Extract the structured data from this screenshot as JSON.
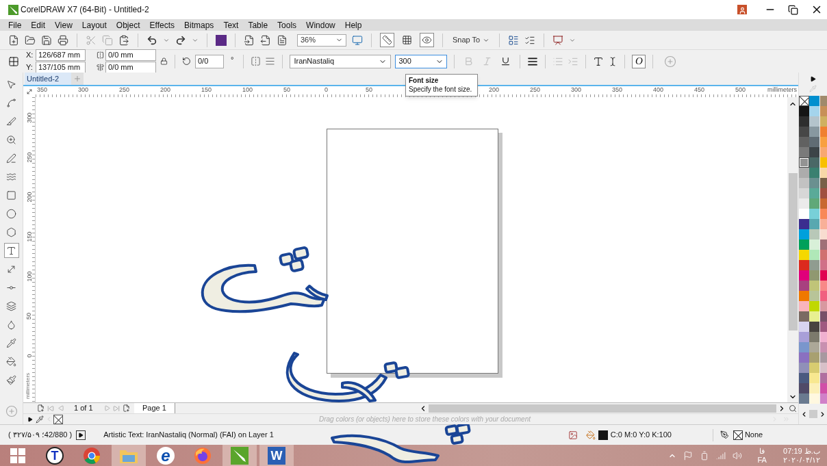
{
  "window": {
    "title": "CorelDRAW X7 (64-Bit) - Untitled-2"
  },
  "menu": [
    "File",
    "Edit",
    "View",
    "Layout",
    "Object",
    "Effects",
    "Bitmaps",
    "Text",
    "Table",
    "Tools",
    "Window",
    "Help"
  ],
  "toolbar": {
    "zoom": "36%",
    "snap": "Snap To",
    "toggles": [
      {
        "kind": "rulers",
        "on": true
      },
      {
        "kind": "grid",
        "on": false
      },
      {
        "kind": "guides",
        "on": true
      }
    ]
  },
  "property_bar": {
    "x_label": "X:",
    "x": "126/687 mm",
    "y_label": "Y:",
    "y": "137/105 mm",
    "width": "0/0 mm",
    "height": "0/0 mm",
    "rotation": "0/0",
    "degree": "°",
    "font": "IranNastaliq",
    "font_size": "300",
    "opentype": "O",
    "text_style": [
      {
        "kind": "bold",
        "disabled": true
      },
      {
        "kind": "italic",
        "disabled": true
      },
      {
        "kind": "underline",
        "disabled": false
      }
    ]
  },
  "tooltip": {
    "title": "Font size",
    "text": "Specify the font size."
  },
  "document_tabs": [
    {
      "label": "Untitled-2",
      "selected": true
    }
  ],
  "ruler": {
    "left_labels": [
      "350",
      "300",
      "250",
      "200",
      "150",
      "100",
      "50",
      "0",
      "50"
    ],
    "right_labels": [
      "200",
      "250",
      "300",
      "350",
      "400",
      "450",
      "500"
    ],
    "unit": "millimeters",
    "vertical_labels": [
      "300",
      "250",
      "200",
      "150",
      "100",
      "50",
      "0"
    ],
    "vertical_unit": "millimeters"
  },
  "tools": [
    {
      "kind": "pick",
      "selected": false
    },
    {
      "kind": "shape",
      "selected": false
    },
    {
      "kind": "crop",
      "selected": false
    },
    {
      "kind": "zoom",
      "selected": false
    },
    {
      "kind": "freehand",
      "selected": false
    },
    {
      "kind": "artistic",
      "selected": false
    },
    {
      "kind": "rectangle",
      "selected": false
    },
    {
      "kind": "ellipse",
      "selected": false
    },
    {
      "kind": "polygon",
      "selected": false
    },
    {
      "kind": "text",
      "selected": true
    },
    {
      "kind": "dimension",
      "selected": false
    },
    {
      "kind": "connector",
      "selected": false
    },
    {
      "kind": "shadow",
      "selected": false
    },
    {
      "kind": "transparency",
      "selected": false
    },
    {
      "kind": "eyedropper",
      "selected": false
    },
    {
      "kind": "fill",
      "selected": false
    },
    {
      "kind": "smart_fill",
      "selected": false
    }
  ],
  "page_nav": {
    "counter": "1 of 1",
    "pages": [
      {
        "label": "Page 1",
        "selected": true
      }
    ]
  },
  "document_palette": {
    "hint": "Drag colors (or objects) here to store these colors with your document"
  },
  "palette": {
    "columns": [
      [
        {
          "kind": "none",
          "selected": false
        },
        {
          "kind": "color",
          "color": "#151515",
          "selected": false
        },
        {
          "kind": "color",
          "color": "#2e2e2e",
          "selected": false
        },
        {
          "kind": "color",
          "color": "#474747",
          "selected": false
        },
        {
          "kind": "color",
          "color": "#616161",
          "selected": false
        },
        {
          "kind": "color",
          "color": "#7a7a7a",
          "selected": false
        },
        {
          "kind": "color",
          "color": "#939393",
          "selected": true
        },
        {
          "kind": "color",
          "color": "#acacac",
          "selected": false
        },
        {
          "kind": "color",
          "color": "#c2c2c2",
          "selected": false
        },
        {
          "kind": "color",
          "color": "#d7d7d7",
          "selected": false
        },
        {
          "kind": "color",
          "color": "#ebebeb",
          "selected": false
        },
        {
          "kind": "color",
          "color": "#ffffff",
          "selected": false
        },
        {
          "kind": "color",
          "color": "#3b2e8f",
          "selected": false
        },
        {
          "kind": "color",
          "color": "#00a0dc",
          "selected": false
        },
        {
          "kind": "color",
          "color": "#00a05a",
          "selected": false
        },
        {
          "kind": "color",
          "color": "#f5d800",
          "selected": false
        },
        {
          "kind": "color",
          "color": "#dc2a1e",
          "selected": false
        },
        {
          "kind": "color",
          "color": "#e0007a",
          "selected": false
        },
        {
          "kind": "color",
          "color": "#a8417f",
          "selected": false
        },
        {
          "kind": "color",
          "color": "#f07800",
          "selected": false
        },
        {
          "kind": "color",
          "color": "#f9b4bb",
          "selected": false
        },
        {
          "kind": "color",
          "color": "#7a6a62",
          "selected": false
        },
        {
          "kind": "color",
          "color": "#d8d4f0",
          "selected": false
        },
        {
          "kind": "color",
          "color": "#a89fd8",
          "selected": false
        },
        {
          "kind": "color",
          "color": "#7a96cc",
          "selected": false
        },
        {
          "kind": "color",
          "color": "#8a70c0",
          "selected": false
        },
        {
          "kind": "color",
          "color": "#9090b8",
          "selected": false
        },
        {
          "kind": "color",
          "color": "#4a5a80",
          "selected": false
        },
        {
          "kind": "color",
          "color": "#504a68",
          "selected": false
        },
        {
          "kind": "color",
          "color": "#6a7a90",
          "selected": false
        }
      ],
      [
        {
          "kind": "color",
          "color": "#008fcf",
          "selected": false
        },
        {
          "kind": "color",
          "color": "#a4d4ec",
          "selected": false
        },
        {
          "kind": "color",
          "color": "#b4c4cc",
          "selected": false
        },
        {
          "kind": "color",
          "color": "#8898a0",
          "selected": false
        },
        {
          "kind": "color",
          "color": "#606c74",
          "selected": false
        },
        {
          "kind": "color",
          "color": "#3c4448",
          "selected": false
        },
        {
          "kind": "color",
          "color": "#4a6866",
          "selected": false
        },
        {
          "kind": "color",
          "color": "#3a8070",
          "selected": false
        },
        {
          "kind": "color",
          "color": "#6a9090",
          "selected": false
        },
        {
          "kind": "color",
          "color": "#5aaa98",
          "selected": false
        },
        {
          "kind": "color",
          "color": "#60a878",
          "selected": false
        },
        {
          "kind": "color",
          "color": "#78d0d8",
          "selected": false
        },
        {
          "kind": "color",
          "color": "#58a8b0",
          "selected": false
        },
        {
          "kind": "color",
          "color": "#b8c8b8",
          "selected": false
        },
        {
          "kind": "color",
          "color": "#d8f0d8",
          "selected": false
        },
        {
          "kind": "color",
          "color": "#b0e8b8",
          "selected": false
        },
        {
          "kind": "color",
          "color": "#909c90",
          "selected": false
        },
        {
          "kind": "color",
          "color": "#909870",
          "selected": false
        },
        {
          "kind": "color",
          "color": "#c0c478",
          "selected": false
        },
        {
          "kind": "color",
          "color": "#b8c498",
          "selected": false
        },
        {
          "kind": "color",
          "color": "#c0d800",
          "selected": false
        },
        {
          "kind": "color",
          "color": "#e8f090",
          "selected": false
        },
        {
          "kind": "color",
          "color": "#484440",
          "selected": false
        },
        {
          "kind": "color",
          "color": "#7c7a6c",
          "selected": false
        },
        {
          "kind": "color",
          "color": "#aca898",
          "selected": false
        },
        {
          "kind": "color",
          "color": "#a8a070",
          "selected": false
        },
        {
          "kind": "color",
          "color": "#d8cc70",
          "selected": false
        },
        {
          "kind": "color",
          "color": "#f8e890",
          "selected": false
        },
        {
          "kind": "color",
          "color": "#fcf0b8",
          "selected": false
        },
        {
          "kind": "color",
          "color": "#fff8e0",
          "selected": false
        }
      ],
      [
        {
          "kind": "color",
          "color": "#a08a6c",
          "selected": false
        },
        {
          "kind": "color",
          "color": "#c89058",
          "selected": false
        },
        {
          "kind": "color",
          "color": "#d0b060",
          "selected": false
        },
        {
          "kind": "color",
          "color": "#f08030",
          "selected": false
        },
        {
          "kind": "color",
          "color": "#f8a040",
          "selected": false
        },
        {
          "kind": "color",
          "color": "#f8a870",
          "selected": false
        },
        {
          "kind": "color",
          "color": "#f8c000",
          "selected": false
        },
        {
          "kind": "color",
          "color": "#f8d8a8",
          "selected": false
        },
        {
          "kind": "color",
          "color": "#786048",
          "selected": false
        },
        {
          "kind": "color",
          "color": "#a05040",
          "selected": false
        },
        {
          "kind": "color",
          "color": "#c86830",
          "selected": false
        },
        {
          "kind": "color",
          "color": "#f88858",
          "selected": false
        },
        {
          "kind": "color",
          "color": "#f8b098",
          "selected": false
        },
        {
          "kind": "color",
          "color": "#f8dcd0",
          "selected": false
        },
        {
          "kind": "color",
          "color": "#a07078",
          "selected": false
        },
        {
          "kind": "color",
          "color": "#d07070",
          "selected": false
        },
        {
          "kind": "color",
          "color": "#d07088",
          "selected": false
        },
        {
          "kind": "color",
          "color": "#e00050",
          "selected": false
        },
        {
          "kind": "color",
          "color": "#f88888",
          "selected": false
        },
        {
          "kind": "color",
          "color": "#f06080",
          "selected": false
        },
        {
          "kind": "color",
          "color": "#d898a0",
          "selected": false
        },
        {
          "kind": "color",
          "color": "#785068",
          "selected": false
        },
        {
          "kind": "color",
          "color": "#a05880",
          "selected": false
        },
        {
          "kind": "color",
          "color": "#f0b0d0",
          "selected": false
        },
        {
          "kind": "color",
          "color": "#c890b0",
          "selected": false
        },
        {
          "kind": "color",
          "color": "#a898a0",
          "selected": false
        },
        {
          "kind": "color",
          "color": "#d8c0c8",
          "selected": false
        },
        {
          "kind": "color",
          "color": "#b070a0",
          "selected": false
        },
        {
          "kind": "color",
          "color": "#d050a8",
          "selected": false
        },
        {
          "kind": "color",
          "color": "#d080c8",
          "selected": false
        }
      ]
    ]
  },
  "status": {
    "coords": "( ۳۲۷/۵۰۹ ؛42/880 )",
    "info": "Artistic Text: IranNastaliq (Normal) (FAI) on Layer 1",
    "fill_text": "C:0 M:0 Y:0 K:100",
    "outline": "None"
  },
  "taskbar": {
    "apps": [
      {
        "kind": "windows",
        "active": false
      },
      {
        "kind": "letter",
        "glyph": "T",
        "active": false
      },
      {
        "kind": "chrome",
        "active": false
      },
      {
        "kind": "explorer",
        "active": true
      },
      {
        "kind": "ie",
        "glyph": "e",
        "active": false
      },
      {
        "kind": "firefox",
        "active": false
      },
      {
        "kind": "corel",
        "active": true
      },
      {
        "kind": "word",
        "glyph": "W",
        "active": true
      }
    ]
  },
  "tray": {
    "language_native": "فا",
    "language": "FA",
    "time": "07:19 ب.ظ",
    "date": "۲۰۲۰/۰۴/۱۲"
  }
}
